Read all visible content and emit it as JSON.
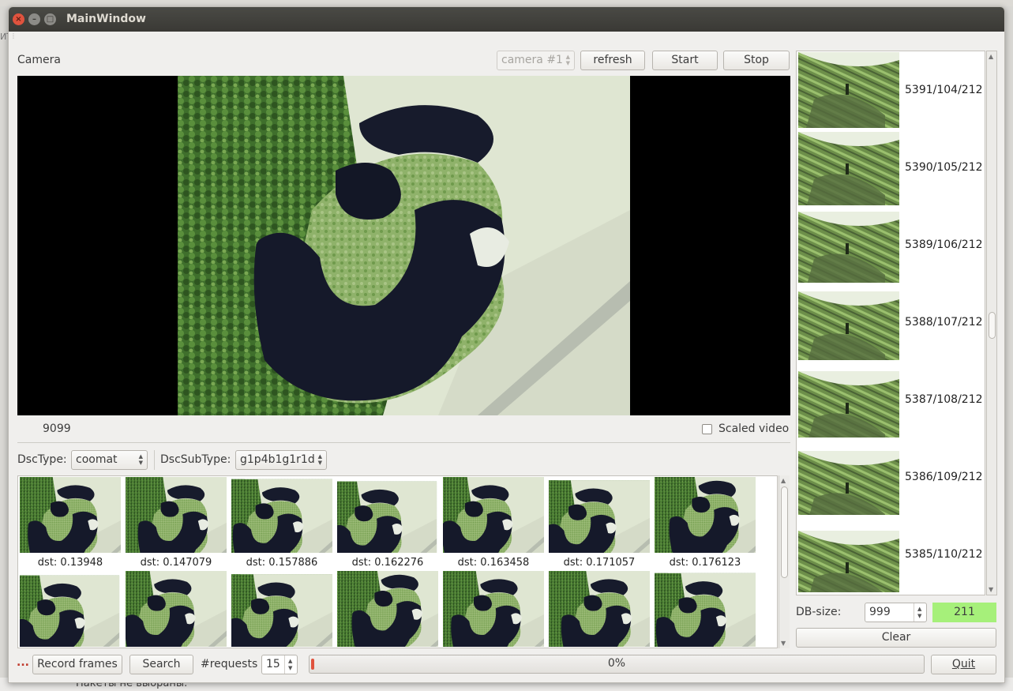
{
  "background": {
    "bottom_text": "Пакеты не выбраны.",
    "left_fragment": "ИТ"
  },
  "window": {
    "title": "MainWindow",
    "close_glyph": "×",
    "min_glyph": "–",
    "max_glyph": "□"
  },
  "camera": {
    "label": "Camera",
    "combo_value": "camera #1",
    "refresh_label": "refresh",
    "start_label": "Start",
    "stop_label": "Stop",
    "frame_counter": "9099",
    "scaled_video_label": "Scaled video",
    "scaled_video_checked": false
  },
  "descriptor": {
    "type_label": "DscType:",
    "type_value": "coomat",
    "subtype_label": "DscSubType:",
    "subtype_value": "g1p4b1g1r1d"
  },
  "results": {
    "row1": [
      {
        "caption": "dst: 0.13948"
      },
      {
        "caption": "dst: 0.147079"
      },
      {
        "caption": "dst: 0.157886"
      },
      {
        "caption": "dst: 0.162276"
      },
      {
        "caption": "dst: 0.163458"
      },
      {
        "caption": "dst: 0.171057"
      },
      {
        "caption": "dst: 0.176123"
      }
    ],
    "row2_count": 7
  },
  "database": {
    "items": [
      {
        "caption": "5391/104/212"
      },
      {
        "caption": "5390/105/212"
      },
      {
        "caption": "5389/106/212"
      },
      {
        "caption": "5388/107/212"
      },
      {
        "caption": "5387/108/212"
      },
      {
        "caption": "5386/109/212"
      },
      {
        "caption": "5385/110/212"
      }
    ],
    "size_label": "DB-size:",
    "size_value": "999",
    "count_value": "211",
    "count_color": "#a6f07a",
    "clear_label": "Clear"
  },
  "bottom": {
    "dots": "...",
    "record_label": "Record frames",
    "search_label": "Search",
    "requests_label": "#requests",
    "requests_value": "15",
    "progress_percent": 0,
    "progress_text": "0%",
    "quit_label": "Quit"
  },
  "colors": {
    "titlebar": "#3c3b37",
    "close_button": "#e0533e",
    "window_bg": "#f0efed"
  }
}
